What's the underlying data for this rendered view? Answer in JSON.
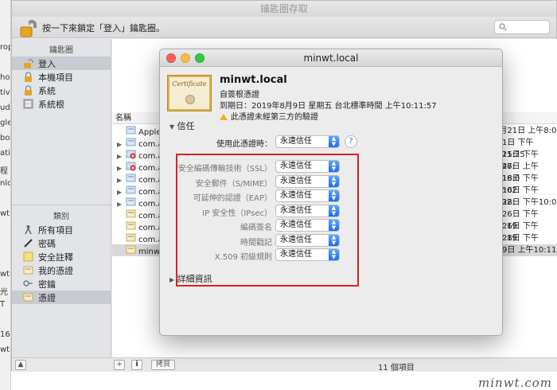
{
  "background_strip": [
    "rop",
    "",
    "ho",
    "tive",
    "ud",
    "gle",
    "bo",
    "ativ",
    "程",
    "nlo",
    "",
    "wt",
    "",
    "",
    "",
    "wt-",
    "光",
    "T",
    "",
    "16pc",
    "wt-"
  ],
  "keychain": {
    "title": "鑰匙圈存取",
    "lock_text": "按一下來鎖定「登入」鑰匙圈。",
    "sidebar_header_top": "鑰匙圈",
    "keychains": [
      {
        "label": "登入",
        "icon": "lock-open-icon",
        "selected": true
      },
      {
        "label": "本機項目",
        "icon": "lock-icon",
        "selected": false
      },
      {
        "label": "系統",
        "icon": "lock-icon",
        "selected": false
      },
      {
        "label": "系統根",
        "icon": "cabinet-icon",
        "selected": false
      }
    ],
    "sidebar_header_bottom": "類別",
    "categories": [
      {
        "label": "所有項目",
        "icon": "people-icon",
        "selected": false
      },
      {
        "label": "密碼",
        "icon": "pen-icon",
        "selected": false
      },
      {
        "label": "安全註釋",
        "icon": "note-icon",
        "selected": false
      },
      {
        "label": "我的憑證",
        "icon": "certificate-icon",
        "selected": false
      },
      {
        "label": "密鑰",
        "icon": "key-icon",
        "selected": false
      },
      {
        "label": "憑證",
        "icon": "certificate-icon",
        "selected": true
      }
    ],
    "column_name": "名稱",
    "rows": [
      {
        "name": "Apple",
        "date": "0月21日 上午8:0",
        "expand": false,
        "icon": "blue",
        "selected": false
      },
      {
        "name": "com.a",
        "date": "月1日 下午5:21:25",
        "expand": true,
        "icon": "blue",
        "selected": false
      },
      {
        "name": "com.a",
        "date": "月15日 下午8:46:",
        "expand": true,
        "icon": "red",
        "selected": false
      },
      {
        "name": "com.a",
        "date": "月27日 上午3:16:0",
        "expand": true,
        "icon": "red",
        "selected": false
      },
      {
        "name": "com.a",
        "date": "月18日 下午12:02",
        "expand": true,
        "icon": "blue",
        "selected": false
      },
      {
        "name": "com.a",
        "date": "月16日 下午6:32:",
        "expand": true,
        "icon": "blue",
        "selected": false
      },
      {
        "name": "com.a",
        "date": "月28日 下午10:0",
        "expand": true,
        "icon": "blue",
        "selected": false
      },
      {
        "name": "com.a",
        "date": "月26日 下午12:19",
        "expand": false,
        "icon": "gold",
        "selected": false
      },
      {
        "name": "com.a",
        "date": "月26日 下午12:19",
        "expand": false,
        "icon": "gold",
        "selected": false
      },
      {
        "name": "com.a",
        "date": "月28日 下午12:19",
        "expand": false,
        "icon": "gold",
        "selected": false
      },
      {
        "name": "minwt",
        "date": "月9日 上午10:11",
        "expand": false,
        "icon": "gold",
        "selected": true
      }
    ],
    "status_count": "11 個項目",
    "status_copy": "拷貝"
  },
  "dialog": {
    "title": "minwt.local",
    "cert_name": "minwt.local",
    "cert_word": "Certificate",
    "cert_type": "自簽根憑證",
    "expiry": "到期日：2019年8月9日 星期五 台北標準時間 上午10:11:57",
    "warning": "此憑證未經第三方的驗證",
    "trust_header": "信任",
    "when_using_label": "使用此憑證時：",
    "when_using_value": "永遠信任",
    "policies": [
      {
        "label": "安全編碼傳輸技術（SSL）",
        "value": "永遠信任"
      },
      {
        "label": "安全郵件（S/MIME）",
        "value": "永遠信任"
      },
      {
        "label": "可延伸的認證（EAP）",
        "value": "永遠信任"
      },
      {
        "label": "IP 安全性（IPsec）",
        "value": "永遠信任"
      },
      {
        "label": "編碼簽名",
        "value": "永遠信任"
      },
      {
        "label": "時間戳記",
        "value": "永遠信任"
      },
      {
        "label": "X.509 初級規則",
        "value": "永遠信任"
      }
    ],
    "details_header": "詳細資訊"
  },
  "watermark": "minwt.com",
  "colors": {
    "highlight_box": "#e02020",
    "popup_accent": "#1a6ef0"
  }
}
